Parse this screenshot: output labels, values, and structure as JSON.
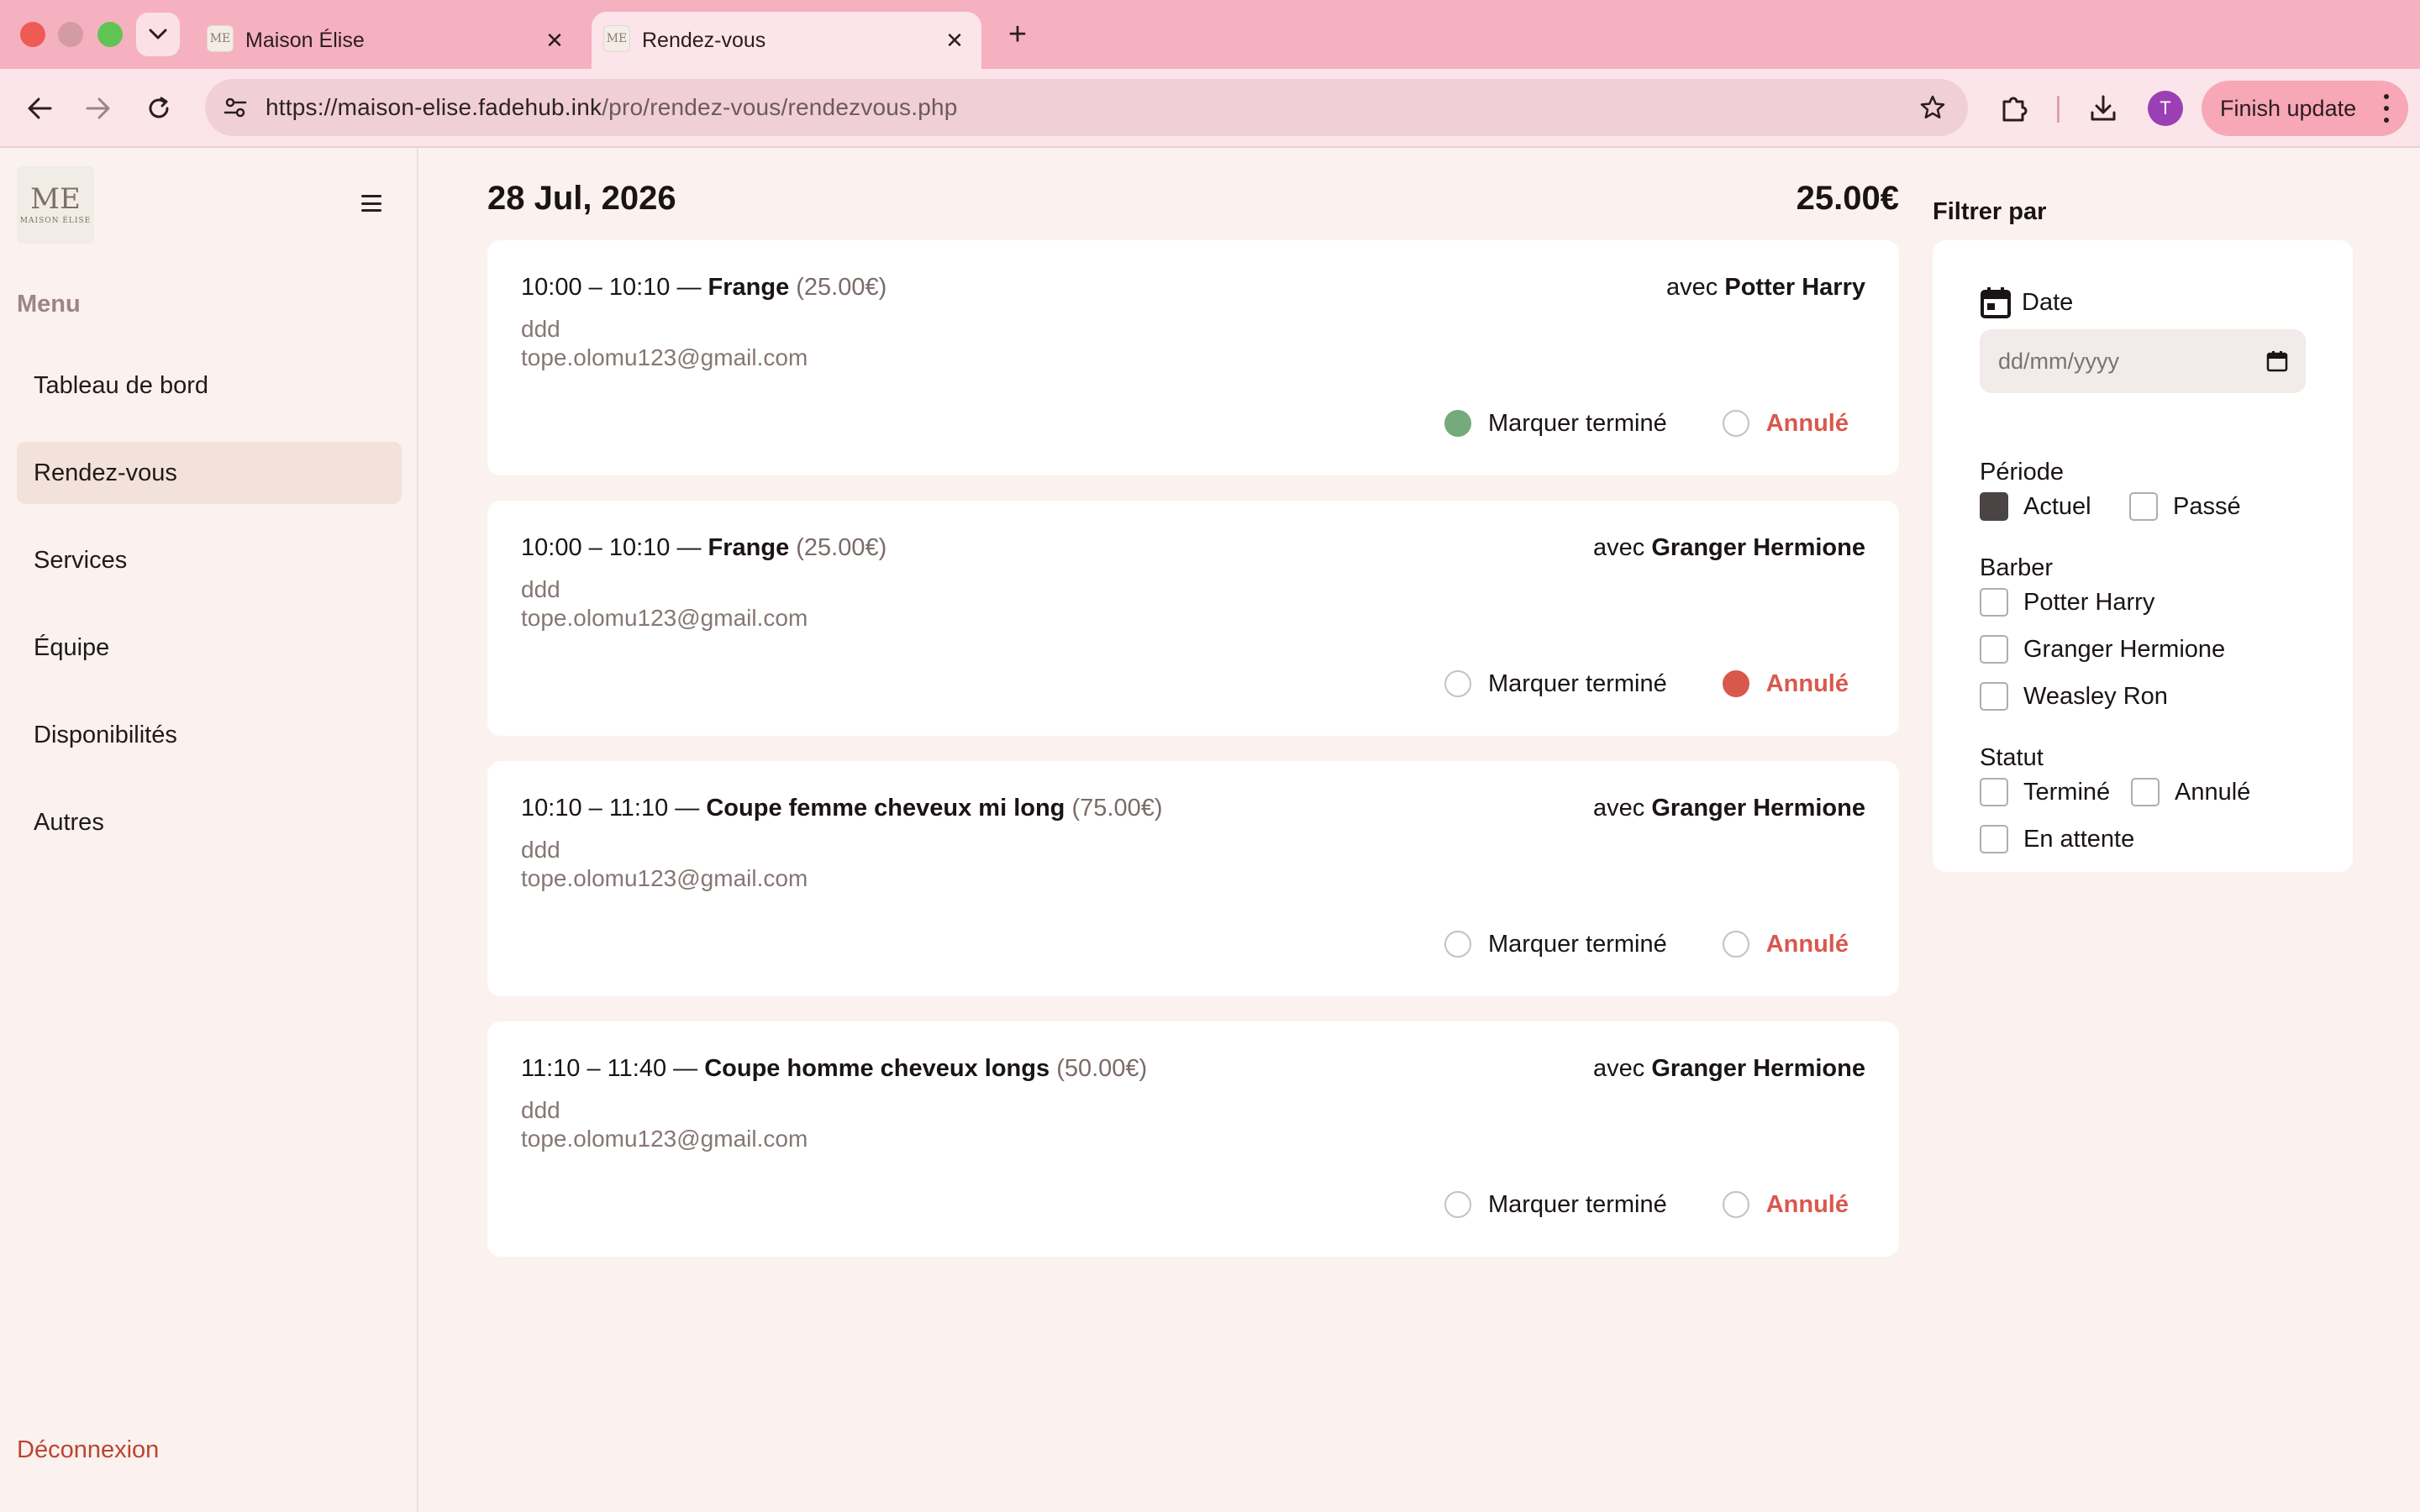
{
  "browser": {
    "tabs": [
      {
        "title": "Maison Élise",
        "active": false
      },
      {
        "title": "Rendez-vous",
        "active": true
      }
    ],
    "url_host": "https://maison-elise.fadehub.ink",
    "url_path": "/pro/rendez-vous/rendezvous.php",
    "avatar_letter": "T",
    "update_label": "Finish update"
  },
  "sidebar": {
    "menu_label": "Menu",
    "items": [
      {
        "label": "Tableau de bord",
        "active": false
      },
      {
        "label": "Rendez-vous",
        "active": true
      },
      {
        "label": "Services",
        "active": false
      },
      {
        "label": "Équipe",
        "active": false
      },
      {
        "label": "Disponibilités",
        "active": false
      },
      {
        "label": "Autres",
        "active": false
      }
    ],
    "logout_label": "Déconnexion"
  },
  "main": {
    "date": "28 Jul, 2026",
    "total": "25.00€",
    "appointments": [
      {
        "time": "10:00 – 10:10 —",
        "service": "Frange",
        "price": "(25.00€)",
        "avec": "avec",
        "barber": "Potter Harry",
        "note": "ddd",
        "email": "tope.olomu123@gmail.com",
        "status": "done"
      },
      {
        "time": "10:00 – 10:10 —",
        "service": "Frange",
        "price": "(25.00€)",
        "avec": "avec",
        "barber": "Granger Hermione",
        "note": "ddd",
        "email": "tope.olomu123@gmail.com",
        "status": "cancel"
      },
      {
        "time": "10:10 – 11:10 —",
        "service": "Coupe femme cheveux mi long",
        "price": "(75.00€)",
        "avec": "avec",
        "barber": "Granger Hermione",
        "note": "ddd",
        "email": "tope.olomu123@gmail.com",
        "status": "none"
      },
      {
        "time": "11:10 – 11:40 —",
        "service": "Coupe homme cheveux longs",
        "price": "(50.00€)",
        "avec": "avec",
        "barber": "Granger Hermione",
        "note": "ddd",
        "email": "tope.olomu123@gmail.com",
        "status": "none"
      }
    ],
    "mark_done_label": "Marquer terminé",
    "cancel_label": "Annulé"
  },
  "filter": {
    "title": "Filtrer par",
    "date_label": "Date",
    "date_placeholder": "dd/mm/yyyy",
    "periode_label": "Période",
    "periode_options": [
      {
        "label": "Actuel",
        "checked": true
      },
      {
        "label": "Passé",
        "checked": false
      }
    ],
    "barber_label": "Barber",
    "barbers": [
      {
        "label": "Potter Harry",
        "checked": false
      },
      {
        "label": "Granger Hermione",
        "checked": false
      },
      {
        "label": "Weasley Ron",
        "checked": false
      }
    ],
    "statut_label": "Statut",
    "statuts": [
      {
        "label": "Terminé",
        "checked": false
      },
      {
        "label": "Annulé",
        "checked": false
      },
      {
        "label": "En attente",
        "checked": false
      }
    ]
  },
  "colors": {
    "tab_bar": "#f5b1bf",
    "page_bg": "#fbf1ef",
    "active_menu": "#f3e2d9",
    "done_green": "#75ab7a",
    "cancel_red": "#d9584e",
    "logout_red": "#b8462f"
  }
}
